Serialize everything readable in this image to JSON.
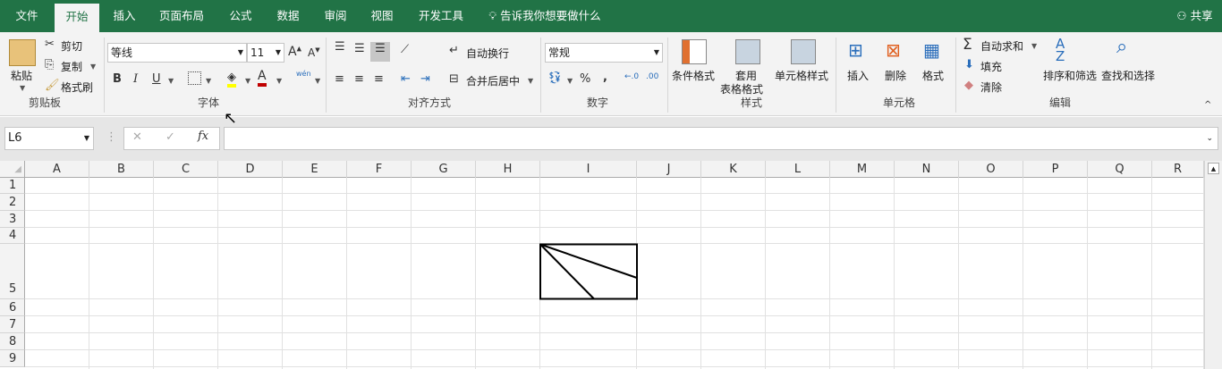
{
  "tabs": [
    "文件",
    "开始",
    "插入",
    "页面布局",
    "公式",
    "数据",
    "审阅",
    "视图",
    "开发工具"
  ],
  "tell_me": "告诉我你想要做什么",
  "share": "共享",
  "clipboard": {
    "paste": "粘贴",
    "cut": "剪切",
    "copy": "复制",
    "format_painter": "格式刷",
    "group": "剪贴板"
  },
  "font": {
    "name": "等线",
    "size": "11",
    "bold": "B",
    "italic": "I",
    "underline": "U",
    "phonetic": "wén",
    "group": "字体"
  },
  "alignment": {
    "wrap": "自动换行",
    "merge": "合并后居中",
    "group": "对齐方式"
  },
  "number": {
    "format": "常规",
    "percent": "%",
    "comma": ",",
    "group": "数字"
  },
  "styles": {
    "conditional": "条件格式",
    "table1": "套用",
    "table2": "表格格式",
    "cell_styles": "单元格样式",
    "group": "样式"
  },
  "cells": {
    "insert": "插入",
    "delete": "删除",
    "format": "格式",
    "group": "单元格"
  },
  "editing": {
    "autosum": "自动求和",
    "fill": "填充",
    "clear": "清除",
    "sort": "排序和筛选",
    "find": "查找和选择",
    "group": "编辑"
  },
  "formula": {
    "name_box": "L6",
    "value": "",
    "fx": "fx"
  },
  "columns": [
    "A",
    "B",
    "C",
    "D",
    "E",
    "F",
    "G",
    "H",
    "I",
    "J",
    "K",
    "L",
    "M",
    "N",
    "O",
    "P",
    "Q",
    "R"
  ],
  "rows": [
    "1",
    "2",
    "3",
    "4",
    "5",
    "6",
    "7",
    "8",
    "9"
  ],
  "colors": {
    "brand": "#217346"
  }
}
